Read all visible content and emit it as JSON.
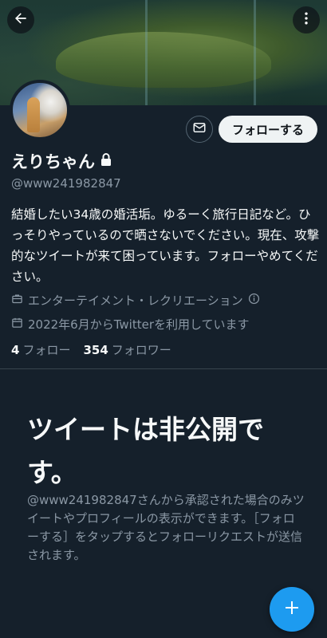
{
  "profile": {
    "display_name": "えりちゃん",
    "handle": "@www241982847",
    "bio": "結婚したい34歳の婚活垢。ゆるーく旅行日記など。ひっそりやっているので晒さないでください。現在、攻撃的なツイートが来て困っています。フォローやめてください。",
    "category": "エンターテイメント・レクリエーション",
    "joined": "2022年6月からTwitterを利用しています",
    "following_count": "4",
    "following_label": "フォロー",
    "followers_count": "354",
    "followers_label": "フォロワー"
  },
  "actions": {
    "follow_label": "フォローする"
  },
  "private_notice": {
    "title": "ツイートは非公開です。",
    "description": "@www241982847さんから承認された場合のみツイートやプロフィールの表示ができます。［フォローする］をタップするとフォローリクエストが送信されます。"
  },
  "icons": {
    "back": "arrow-left-icon",
    "more": "more-vertical-icon",
    "lock": "lock-icon",
    "mail": "mail-icon",
    "category": "briefcase-icon",
    "joined": "calendar-icon",
    "info": "info-icon",
    "compose": "plus-icon"
  },
  "colors": {
    "background": "#15202b",
    "accent": "#1d9bf0",
    "secondary_text": "#8b98a5"
  }
}
